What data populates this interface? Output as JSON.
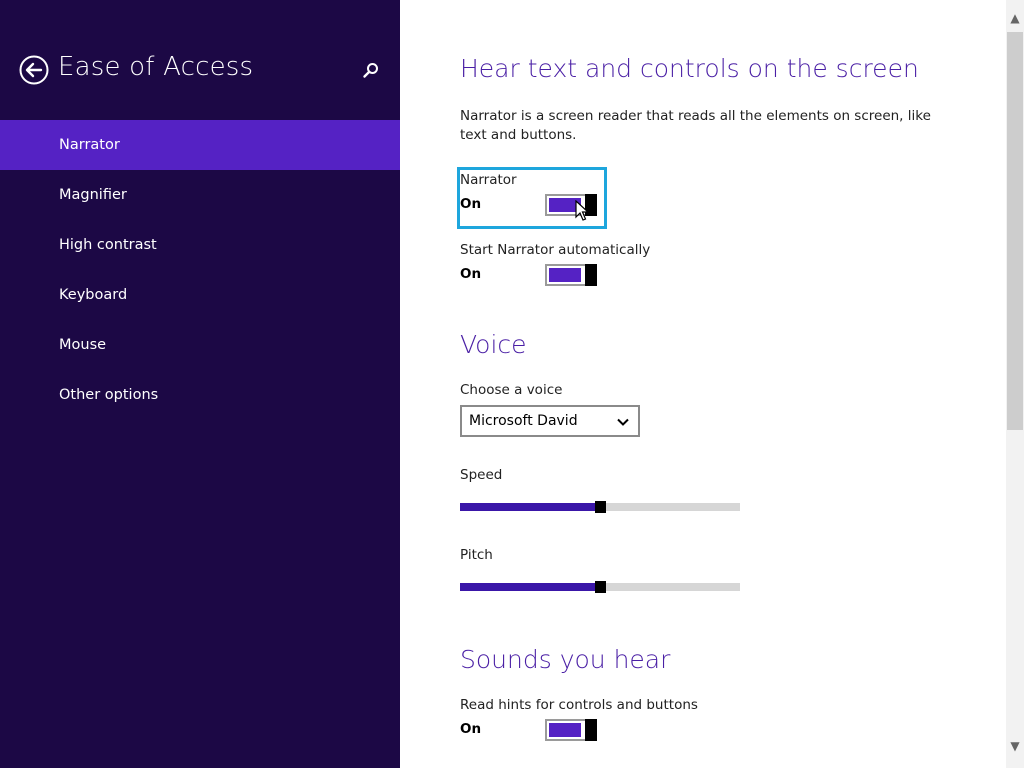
{
  "sidebar": {
    "title": "Ease of Access",
    "items": [
      {
        "label": "Narrator"
      },
      {
        "label": "Magnifier"
      },
      {
        "label": "High contrast"
      },
      {
        "label": "Keyboard"
      },
      {
        "label": "Mouse"
      },
      {
        "label": "Other options"
      }
    ],
    "selected": "Narrator",
    "icons": {
      "back": "back-arrow-circle-icon",
      "search": "search-icon"
    }
  },
  "content": {
    "heading1": "Hear text and controls on the screen",
    "description": "Narrator is a screen reader that reads all the elements on screen, like text and buttons.",
    "narrator_toggle": {
      "label": "Narrator",
      "state": "On"
    },
    "auto_start_toggle": {
      "label": "Start Narrator automatically",
      "state": "On"
    },
    "heading2": "Voice",
    "voice": {
      "label": "Choose a voice",
      "value": "Microsoft David"
    },
    "speed": {
      "label": "Speed",
      "value": 0.5
    },
    "pitch": {
      "label": "Pitch",
      "value": 0.5
    },
    "heading3": "Sounds you hear",
    "hints_toggle": {
      "label": "Read hints for controls and buttons",
      "state": "On"
    }
  },
  "colors": {
    "sidebar_bg": "#1c0845",
    "accent": "#5522c4",
    "heading": "#4a1fa5",
    "focus": "#1ea6dd"
  }
}
